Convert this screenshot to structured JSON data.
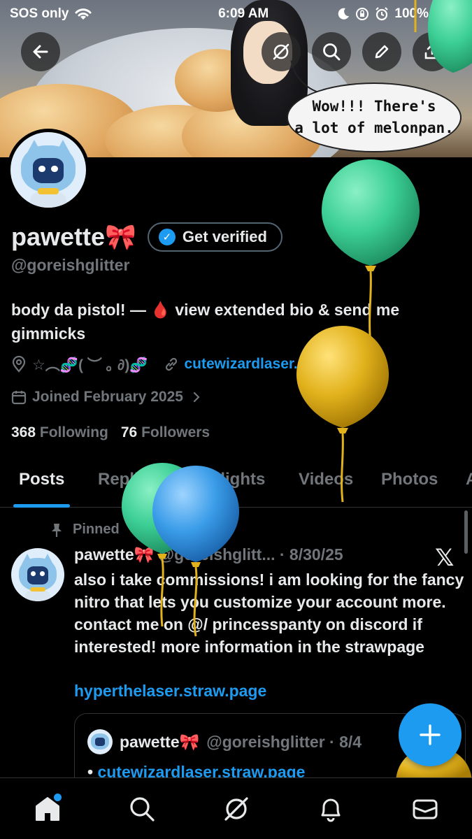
{
  "status_bar": {
    "carrier": "SOS only",
    "time": "6:09 AM",
    "battery": "100%",
    "battery_level": 1.0
  },
  "header": {
    "buttons": [
      "back-icon",
      "grok-icon",
      "search-icon",
      "edit-icon",
      "share-icon"
    ]
  },
  "banner": {
    "speech_line1": "Wow!!! There's",
    "speech_line2": "a lot of melonpan."
  },
  "profile": {
    "name": "pawette🎀",
    "verify_label": "Get verified",
    "handle": "@goreishglitter",
    "bio": "body da pistol! — 🩸 view extended bio & send me gimmicks",
    "location": "☆︵🧬( ︶ ｡ ∂)🧬",
    "website": "cutewizardlaser.straw.page",
    "joined": "Joined February 2025",
    "following_count": "368",
    "following_label": "Following",
    "followers_count": "76",
    "followers_label": "Followers"
  },
  "tabs": [
    "Posts",
    "Replies",
    "Highlights",
    "Videos",
    "Photos",
    "A"
  ],
  "pinned_post": {
    "pinned_label": "Pinned",
    "name": "pawette🎀",
    "meta": " @goreishglitt... · 8/30/25",
    "text": "also i take commissions! i am looking for the fancy nitro that lets you customize your account more. contact me on @/ princesspanty on discord if interested! more information in the strawpage",
    "link": "hyperthelaser.straw.page",
    "quote": {
      "name": "pawette🎀",
      "meta": " @goreishglitter · 8/4",
      "link": "cutewizardlaser.straw.page",
      "bullet": "•"
    }
  },
  "bottom_nav": [
    "home-icon",
    "search-icon",
    "grok-icon",
    "notifications-icon",
    "messages-icon"
  ],
  "colors": {
    "accent": "#1d9bf0",
    "background": "#000000",
    "text_primary": "#e7e9ea",
    "text_secondary": "#71767b",
    "balloon_green": "#3ccf95",
    "balloon_yellow": "#e2b21c",
    "balloon_blue": "#3a9ce8"
  }
}
